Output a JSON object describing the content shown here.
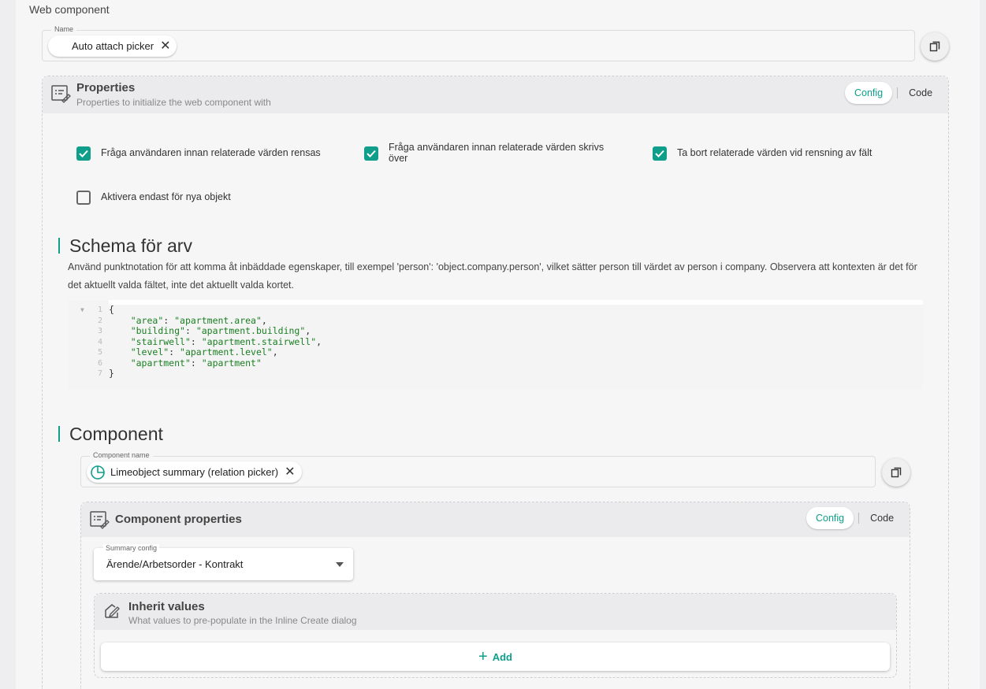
{
  "web_component": {
    "title": "Web component",
    "name_field": {
      "label": "Name",
      "chip_label": "Auto attach picker"
    }
  },
  "properties": {
    "title": "Properties",
    "subtitle": "Properties to initialize the web component with",
    "toggle": {
      "config": "Config",
      "code": "Code",
      "active": "Config"
    },
    "checkboxes": [
      {
        "label": "Fråga användaren innan relaterade värden rensas",
        "checked": true
      },
      {
        "label": "Fråga användaren innan relaterade värden skrivs över",
        "checked": true
      },
      {
        "label": "Ta bort relaterade värden vid rensning av fält",
        "checked": true
      },
      {
        "label": "Aktivera endast för nya objekt",
        "checked": false
      }
    ]
  },
  "schema": {
    "heading": "Schema för arv",
    "description": "Använd punktnotation för att komma åt inbäddade egenskaper, till exempel 'person': 'object.company.person', vilket sätter person till värdet av person i company. Observera att kontexten är det för det aktuellt valda fältet, inte det aktuellt valda kortet.",
    "code_lines": [
      {
        "n": "1",
        "text": "{"
      },
      {
        "n": "2",
        "key": "\"area\"",
        "value": "\"apartment.area\"",
        "comma": ","
      },
      {
        "n": "3",
        "key": "\"building\"",
        "value": "\"apartment.building\"",
        "comma": ","
      },
      {
        "n": "4",
        "key": "\"stairwell\"",
        "value": "\"apartment.stairwell\"",
        "comma": ","
      },
      {
        "n": "5",
        "key": "\"level\"",
        "value": "\"apartment.level\"",
        "comma": ","
      },
      {
        "n": "6",
        "key": "\"apartment\"",
        "value": "\"apartment\"",
        "comma": ""
      },
      {
        "n": "7",
        "text": "}"
      }
    ]
  },
  "component": {
    "heading": "Component",
    "name_field": {
      "label": "Component name",
      "chip_label": "Limeobject summary (relation picker)"
    },
    "properties": {
      "title": "Component properties",
      "toggle": {
        "config": "Config",
        "code": "Code",
        "active": "Config"
      },
      "summary_config": {
        "label": "Summary config",
        "value": "Ärende/Arbetsorder - Kontrakt"
      },
      "inherit": {
        "title": "Inherit values",
        "subtitle": "What values to pre-populate in the Inline Create dialog",
        "add_label": "Add"
      }
    }
  },
  "colors": {
    "accent": "#0e9e8a",
    "code_string": "#1a7f21"
  }
}
